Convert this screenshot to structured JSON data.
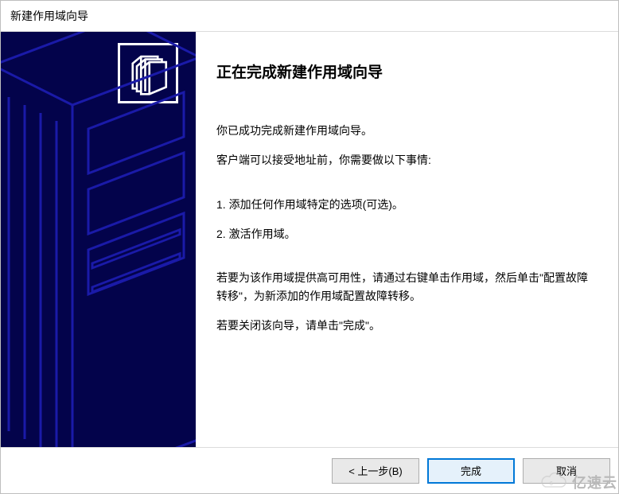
{
  "window": {
    "title": "新建作用域向导"
  },
  "header": {
    "heading": "正在完成新建作用域向导"
  },
  "body": {
    "p1": "你已成功完成新建作用域向导。",
    "p2": "客户端可以接受地址前，你需要做以下事情:",
    "p3": "1. 添加任何作用域特定的选项(可选)。",
    "p4": "2. 激活作用域。",
    "p5": "若要为该作用域提供高可用性，请通过右键单击作用域，然后单击\"配置故障转移\"，为新添加的作用域配置故障转移。",
    "p6": "若要关闭该向导，请单击\"完成\"。"
  },
  "buttons": {
    "back": "< 上一步(B)",
    "finish": "完成",
    "cancel": "取消"
  },
  "icons": {
    "side": "folders-icon",
    "watermark": "cloud-logo"
  },
  "watermark": {
    "text": "亿速云"
  }
}
